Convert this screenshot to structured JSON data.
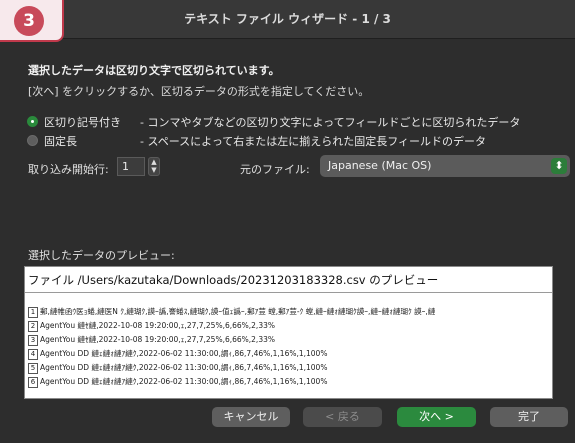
{
  "window": {
    "title": "テキスト ファイル ウィザード - 1 / 3",
    "step_badge": "3"
  },
  "intro": {
    "heading": "選択したデータは区切り文字で区切られています。",
    "subtext": "[次へ] をクリックするか、区切るデータの形式を指定してください。"
  },
  "options": [
    {
      "label": "区切り記号付き",
      "description": "- コンマやタブなどの区切り文字によってフィールドごとに区切られたデータ",
      "selected": true
    },
    {
      "label": "固定長",
      "description": "- スペースによって右または左に揃えられた固定長フィールドのデータ",
      "selected": false
    }
  ],
  "import_start": {
    "label": "取り込み開始行:",
    "value": "1",
    "stepper_up": "▲",
    "stepper_down": "▼"
  },
  "origin": {
    "label": "元のファイル:",
    "value": "Japanese (Mac OS)",
    "arrow": "⬍"
  },
  "preview": {
    "label": "選択したデータのプレビュー:",
    "title": "ファイル /Users/kazutaka/Downloads/20231203183328.csv のプレビュー",
    "rows": [
      {
        "num": "1",
        "text": "郵,縺帷函ｳ医ｮ蜷,縺医N ｸ,縺瑚ｸ,謨ｰ譌,謇蜷ｽ,縺瑚ｸ,謨ｰ值ｪ譌ｰ,郵ｱ荳 螳,郵ｱ荳-ｸ 螳,縺ｰ縺ｫ縺瑚ｸ謨ｰ,縺ｰ縺ｫ縺瑚ｸ 謨ｰ,縺"
      },
      {
        "num": "2",
        "text": "AgentYou 縺ｾ縺,2022-10-08 19:20:00,ｪ,27,7,25%,6,66%,2,33%"
      },
      {
        "num": "3",
        "text": "AgentYou 縺ｾ縺,2022-10-08 19:20:00,ｪ,27,7,25%,6,66%,2,33%"
      },
      {
        "num": "4",
        "text": "AgentYou DD 縺ｪ縺ｫ縺ｱ縺ｸ,2022-06-02 11:30:00,謂ｨ,86,7,46%,1,16%,1,100%"
      },
      {
        "num": "5",
        "text": "AgentYou DD 縺ｪ縺ｫ縺ｱ縺ｸ,2022-06-02 11:30:00,謂ｨ,86,7,46%,1,16%,1,100%"
      },
      {
        "num": "6",
        "text": "AgentYou DD 縺ｪ縺ｫ縺ｱ縺ｸ,2022-06-02 11:30:00,謂ｨ,86,7,46%,1,16%,1,100%"
      }
    ]
  },
  "buttons": {
    "cancel": "キャンセル",
    "back": "< 戻る",
    "next": "次へ >",
    "finish": "完了"
  },
  "colors": {
    "accent": "#2b8a3e",
    "badge": "#c84a5a"
  }
}
